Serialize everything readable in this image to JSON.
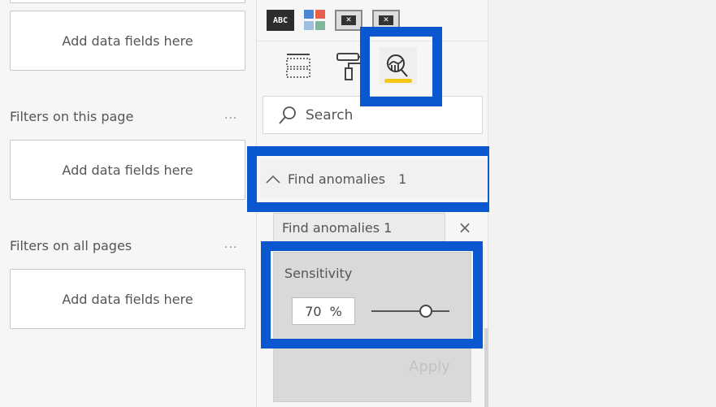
{
  "filters_pane": {
    "drop_placeholder_1": "Add data fields here",
    "filters_on_this_page": {
      "title": "Filters on this page",
      "more": "...",
      "placeholder": "Add data fields here"
    },
    "filters_on_all_pages": {
      "title": "Filters on all pages",
      "more": "...",
      "placeholder": "Add data fields here"
    }
  },
  "viz_pane": {
    "visual_icons": [
      {
        "name": "text-filter-visual",
        "label": "ABC"
      },
      {
        "name": "grid-visual"
      },
      {
        "name": "image-visual",
        "glyph": "✕"
      },
      {
        "name": "image-visual-alt",
        "glyph": "✕"
      }
    ],
    "grid_colors": [
      "#4a86d4",
      "#e8604c",
      "#9cbfe0",
      "#7fb59c"
    ],
    "tabs": [
      {
        "name": "fields",
        "active": false
      },
      {
        "name": "format",
        "active": false
      },
      {
        "name": "analytics",
        "active": true
      }
    ],
    "search": {
      "placeholder": "Search"
    },
    "section": {
      "title": "Find anomalies",
      "count": "1"
    },
    "card": {
      "title": "Find anomalies 1",
      "close": "×",
      "sensitivity_label": "Sensitivity",
      "sensitivity_value": "70",
      "sensitivity_unit": "%",
      "sensitivity_percent": 70,
      "apply_label": "Apply"
    }
  },
  "colors": {
    "highlight": "#0b57d0",
    "active_tab_underline": "#f2c811"
  }
}
